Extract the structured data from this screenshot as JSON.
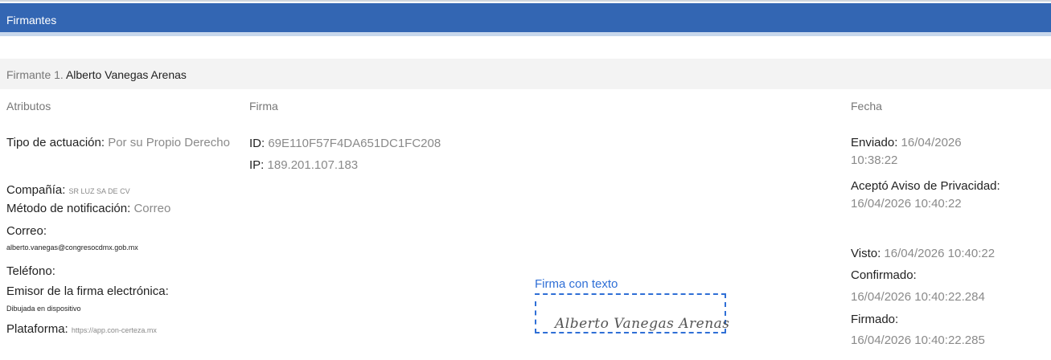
{
  "section": {
    "title": "Firmantes"
  },
  "signer": {
    "prefix": "Firmante 1.",
    "name": "Alberto Vanegas Arenas"
  },
  "columns": {
    "attributes": "Atributos",
    "signature": "Firma",
    "date": "Fecha"
  },
  "attributes": {
    "tipo_label": "Tipo de actuación:",
    "tipo_value": "Por su Propio Derecho",
    "compania_label": "Compañía:",
    "compania_value": "SR LUZ SA DE CV",
    "metodo_label": "Método de notificación:",
    "metodo_value": "Correo",
    "correo_label": "Correo:",
    "correo_value": "alberto.vanegas@congresocdmx.gob.mx",
    "telefono_label": "Teléfono:",
    "emisor_label": "Emisor de la firma electrónica:",
    "emisor_value": "Dibujada en dispositivo",
    "plataforma_label": "Plataforma:",
    "plataforma_value": "https://app.con-certeza.mx"
  },
  "signature": {
    "id_label": "ID:",
    "id_value": "69E110F57F4DA651DC1FC208",
    "ip_label": "IP:",
    "ip_value": "189.201.107.183",
    "box_label": "Firma con texto",
    "signed_text": "Alberto Vanegas Arenas"
  },
  "dates": {
    "enviado_label": "Enviado:",
    "enviado_value": "16/04/2026 10:38:22",
    "acepto_label": "Aceptó Aviso de Privacidad:",
    "acepto_value": "16/04/2026 10:40:22",
    "visto_label": "Visto:",
    "visto_value": "16/04/2026 10:40:22",
    "confirmado_label": "Confirmado:",
    "confirmado_value": "16/04/2026 10:40:22.284",
    "firmado_label": "Firmado:",
    "firmado_value": "16/04/2026 10:40:22.285"
  }
}
